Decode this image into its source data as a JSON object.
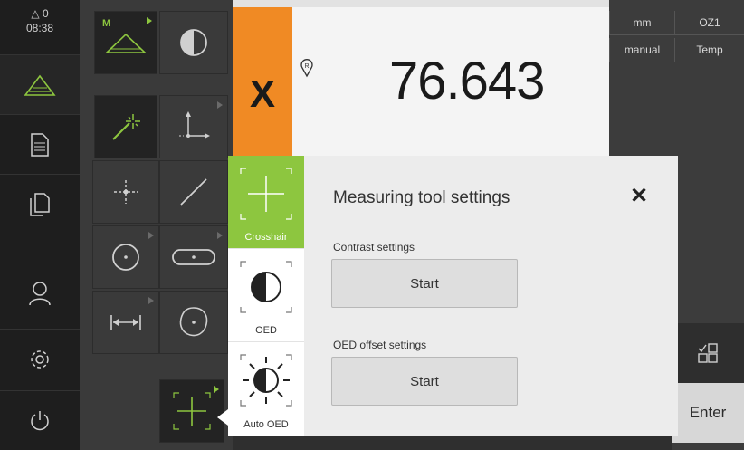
{
  "status": {
    "indicator": "△ 0",
    "time": "08:38"
  },
  "sidebar": {
    "items": [
      {
        "name": "measure",
        "icon": "triangle-icon"
      },
      {
        "name": "journal",
        "icon": "document-icon"
      },
      {
        "name": "file-management",
        "icon": "files-icon"
      },
      {
        "name": "user-login",
        "icon": "user-icon"
      },
      {
        "name": "settings",
        "icon": "gear-icon"
      },
      {
        "name": "switch-off",
        "icon": "power-icon"
      }
    ]
  },
  "tools": {
    "manual_label": "M"
  },
  "position": {
    "axis": "X",
    "value": "76.643",
    "ref_icon": "R"
  },
  "right_panel": {
    "unit": "mm",
    "oz": "OZ1",
    "mode": "manual",
    "temp": "Temp",
    "enter_label": "Enter"
  },
  "popup": {
    "title": "Measuring tool settings",
    "contrast_label": "Contrast settings",
    "contrast_button": "Start",
    "offset_label": "OED offset settings",
    "offset_button": "Start",
    "tools": [
      {
        "label": "Crosshair",
        "active": true
      },
      {
        "label": "OED",
        "active": false
      },
      {
        "label": "Auto OED",
        "active": false
      }
    ]
  },
  "colors": {
    "accent": "#8dc63f",
    "axis": "#f08a24",
    "background": "#2b2b2b"
  }
}
